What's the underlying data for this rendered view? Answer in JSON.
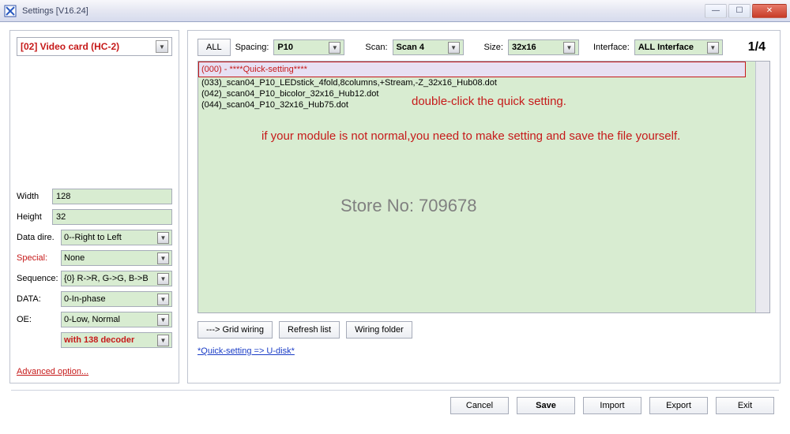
{
  "window": {
    "title": "Settings [V16.24]"
  },
  "left": {
    "card": "[02] Video card (HC-2)",
    "width_label": "Width",
    "width_value": "128",
    "height_label": "Height",
    "height_value": "32",
    "datadir_label": "Data dire.",
    "datadir_value": "0--Right to Left",
    "special_label": "Special:",
    "special_value": "None",
    "sequence_label": "Sequence:",
    "sequence_value": "{0} R->R, G->G, B->B",
    "data_label": "DATA:",
    "data_value": "0-In-phase",
    "oe_label": "OE:",
    "oe_value": "0-Low, Normal",
    "decoder_value": "with 138 decoder",
    "advanced": "Advanced option..."
  },
  "filters": {
    "all": "ALL",
    "spacing_label": "Spacing:",
    "spacing_value": "P10",
    "scan_label": "Scan:",
    "scan_value": "Scan 4",
    "size_label": "Size:",
    "size_value": "32x16",
    "interface_label": "Interface:",
    "interface_value": "ALL Interface",
    "page": "1/4"
  },
  "list": {
    "items": [
      "(000) - ****Quick-setting****",
      "(033)_scan04_P10_LEDstick_4fold,8columns,+Stream,-Z_32x16_Hub08.dot",
      "(042)_scan04_P10_bicolor_32x16_Hub12.dot",
      "(044)_scan04_P10_32x16_Hub75.dot"
    ]
  },
  "annotations": {
    "a1": "double-click the quick setting.",
    "a2": "if your module is not normal,you need to make setting and save the file yourself.",
    "watermark": "Store No: 709678"
  },
  "buttons": {
    "grid": "---> Grid wiring",
    "refresh": "Refresh list",
    "wiring": "Wiring folder",
    "quick": "*Quick-setting => U-disk*",
    "cancel": "Cancel",
    "save": "Save",
    "import": "Import",
    "export": "Export",
    "exit": "Exit"
  }
}
